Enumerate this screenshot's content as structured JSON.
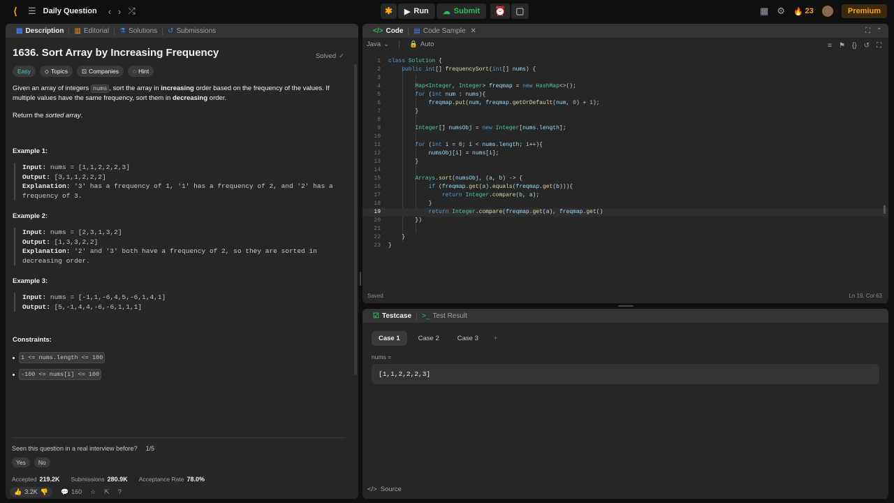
{
  "topbar": {
    "title": "Daily Question",
    "run_label": "Run",
    "submit_label": "Submit",
    "streak": "23",
    "premium_label": "Premium"
  },
  "left_tabs": [
    "Description",
    "Editorial",
    "Solutions",
    "Submissions"
  ],
  "problem": {
    "title": "1636. Sort Array by Increasing Frequency",
    "status": "Solved",
    "difficulty": "Easy",
    "chips": [
      "Topics",
      "Companies",
      "Hint"
    ],
    "desc_1a": "Given an array of integers ",
    "desc_1_code": "nums",
    "desc_1b": ", sort the array in ",
    "desc_1_bold1": "increasing",
    "desc_1c": " order based on the frequency of the values. If multiple values have the same frequency, sort them in ",
    "desc_1_bold2": "decreasing",
    "desc_1d": " order.",
    "desc_2a": "Return the ",
    "desc_2_italic": "sorted array",
    "desc_2b": ".",
    "examples": [
      {
        "title": "Example 1:",
        "input": "nums = [1,1,2,2,2,3]",
        "output": "[3,1,1,2,2,2]",
        "explanation": "'3' has a frequency of 1, '1' has a frequency of 2, and '2' has a frequency of 3."
      },
      {
        "title": "Example 2:",
        "input": "nums = [2,3,1,3,2]",
        "output": "[1,3,3,2,2]",
        "explanation": "'2' and '3' both have a frequency of 2, so they are sorted in decreasing order."
      },
      {
        "title": "Example 3:",
        "input": "nums = [-1,1,-6,4,5,-6,1,4,1]",
        "output": "[5,-1,4,4,-6,-6,1,1,1]"
      }
    ],
    "labels": {
      "input": "Input:",
      "output": "Output:",
      "explanation": "Explanation:"
    },
    "constraints_title": "Constraints:",
    "constraints": [
      "1 <= nums.length <= 100",
      "-100 <= nums[i] <= 100"
    ],
    "interview_q": "Seen this question in a real interview before?",
    "interview_count": "1/5",
    "yes": "Yes",
    "no": "No",
    "accepted_label": "Accepted",
    "accepted_value": "219.2K",
    "submissions_label": "Submissions",
    "submissions_value": "280.9K",
    "acceptance_label": "Acceptance Rate",
    "acceptance_value": "78.0%",
    "likes": "3.2K",
    "comments": "160"
  },
  "code_panel": {
    "tabs": [
      "Code",
      "Code Sample"
    ],
    "language": "Java",
    "auto": "Auto",
    "saved": "Saved",
    "cursor_pos": "Ln 19, Col 63"
  },
  "code_lines": [
    "class Solution {",
    "    public int[] frequencySort(int[] nums) {",
    "",
    "        Map<Integer, Integer> freqmap = new HashMap<>();",
    "        for (int num : nums){",
    "            freqmap.put(num, freqmap.getOrDefault(num, 0) + 1);",
    "        }",
    "",
    "        Integer[] numsObj = new Integer[nums.length];",
    "",
    "        for (int i = 0; i < nums.length; i++){",
    "            numsObj[i] = nums[i];",
    "        }",
    "",
    "        Arrays.sort(numsObj, (a, b) -> {",
    "            if (freqmap.get(a).equals(freqmap.get(b))){",
    "                return Integer.compare(b, a);",
    "            }",
    "            return Integer.compare(freqmap.get(a), freqmap.get()",
    "        })",
    "",
    "    }",
    "}"
  ],
  "test_panel": {
    "tabs": [
      "Testcase",
      "Test Result"
    ],
    "cases": [
      "Case 1",
      "Case 2",
      "Case 3"
    ],
    "var_label": "nums =",
    "value": "[1,1,2,2,2,3]",
    "source_label": "Source"
  }
}
